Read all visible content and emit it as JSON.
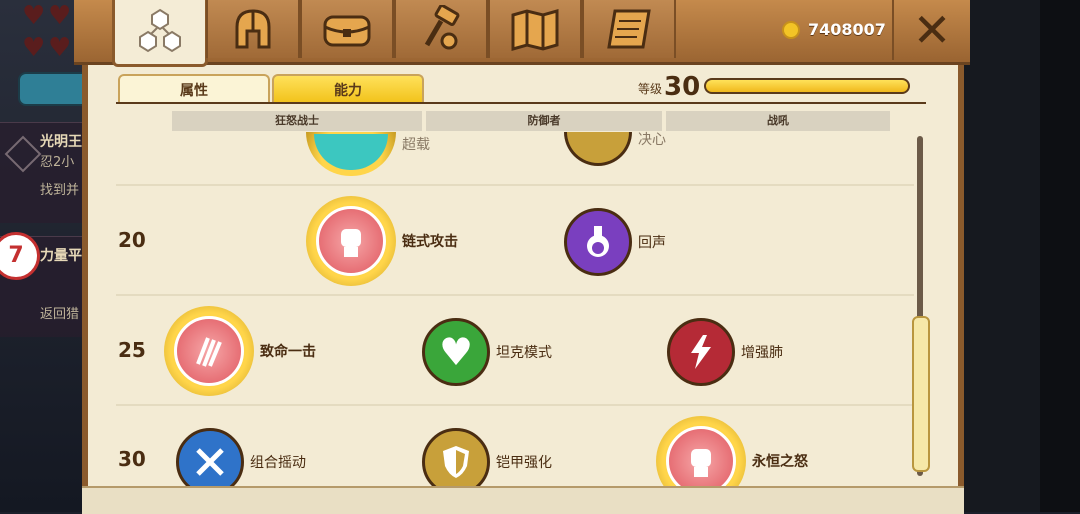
{
  "tabs": [
    {
      "name": "skills-tree",
      "icon": "hexagons-icon",
      "active": true
    },
    {
      "name": "helmet",
      "icon": "helmet-icon"
    },
    {
      "name": "treasure",
      "icon": "chest-icon"
    },
    {
      "name": "craft",
      "icon": "hammer-icon"
    },
    {
      "name": "map",
      "icon": "map-icon"
    },
    {
      "name": "scroll",
      "icon": "scroll-icon"
    }
  ],
  "gold": "7408007",
  "subtabs": {
    "attributes": "属性",
    "abilities": "能力"
  },
  "level": {
    "label": "等级",
    "value": "30",
    "progress": 1.0
  },
  "columns": [
    "狂怒战士",
    "防御者",
    "战吼"
  ],
  "rows": [
    {
      "level": "20",
      "skills": [
        {
          "name": "链式攻击",
          "icon": "fist-icon",
          "color": "#e0575f",
          "selected": true
        },
        {
          "name": "回声",
          "icon": "potion-icon",
          "color": "#7a3fbf"
        }
      ]
    },
    {
      "level": "25",
      "skills": [
        {
          "name": "致命一击",
          "icon": "claw-icon",
          "color": "#e0575f",
          "selected": true
        },
        {
          "name": "坦克模式",
          "icon": "heart-icon",
          "color": "#3aa63a"
        },
        {
          "name": "增强肺",
          "icon": "lightning-icon",
          "color": "#b52a36"
        }
      ]
    },
    {
      "level": "30",
      "skills": [
        {
          "name": "组合摇动",
          "icon": "swords-icon",
          "color": "#2f73c9"
        },
        {
          "name": "铠甲强化",
          "icon": "shield-icon",
          "color": "#c8a03a"
        },
        {
          "name": "永恒之怒",
          "icon": "fist-icon",
          "color": "#e0575f",
          "selected": true
        }
      ]
    }
  ],
  "partial_row": {
    "skills": [
      {
        "name": "超载",
        "icon": "ring-icon",
        "color": "#3cc7c0"
      },
      {
        "name": "决心",
        "icon": "shield-icon",
        "color": "#c8a03a"
      }
    ]
  },
  "hud": {
    "quest1_title": "光明王",
    "quest1_sub1": "忍2小",
    "quest1_sub2": "找到并",
    "quest2_title": "力量平",
    "quest2_sub": "返回猎",
    "badge": "7"
  }
}
